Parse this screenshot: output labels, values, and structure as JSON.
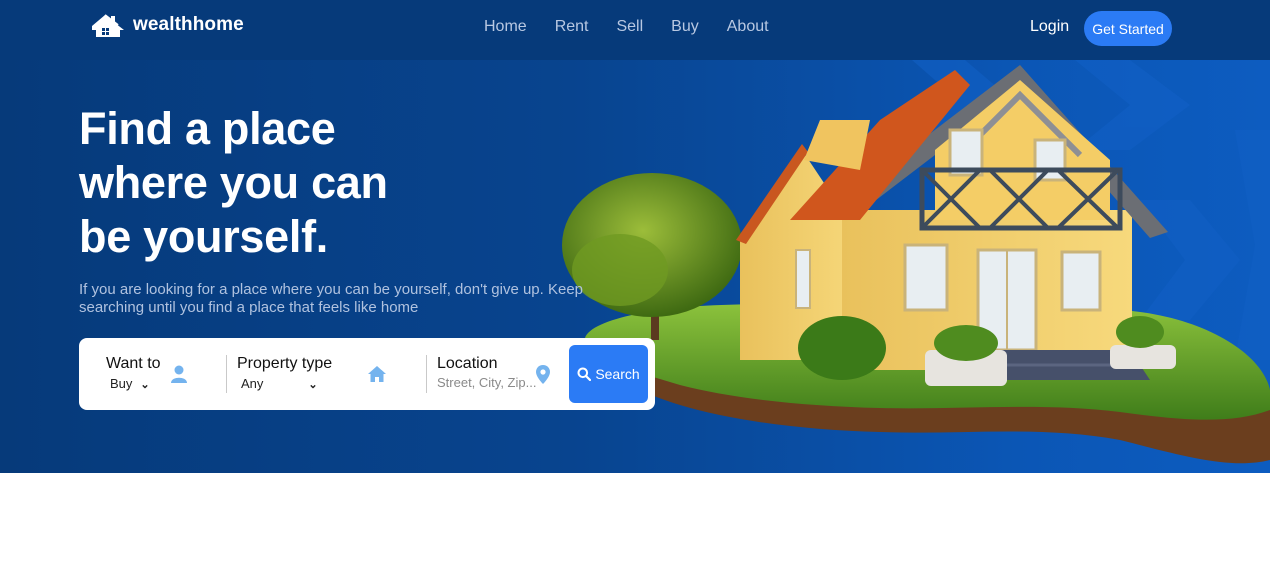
{
  "brand": {
    "name": "wealthhome"
  },
  "nav": {
    "items": [
      "Home",
      "Rent",
      "Sell",
      "Buy",
      "About"
    ]
  },
  "auth": {
    "login": "Login",
    "get_started": "Get Started"
  },
  "hero": {
    "headline_lines": [
      "Find a place",
      "where you can",
      "be yourself."
    ],
    "subtext": "If you are looking for a place where you can be yourself, don't give up. Keep searching until you find a place that feels like home"
  },
  "search": {
    "want_to": {
      "label": "Want to",
      "value": "Buy"
    },
    "property_type": {
      "label": "Property type",
      "value": "Any"
    },
    "location": {
      "label": "Location",
      "placeholder": "Street, City, Zip..."
    },
    "button_label": "Search"
  },
  "colors": {
    "header_bg": "#063a7a",
    "accent": "#2b7bf5",
    "icon": "#74b3ee"
  },
  "icons": [
    "house-logo-icon",
    "user-icon",
    "home-icon",
    "map-pin-icon",
    "search-icon"
  ]
}
